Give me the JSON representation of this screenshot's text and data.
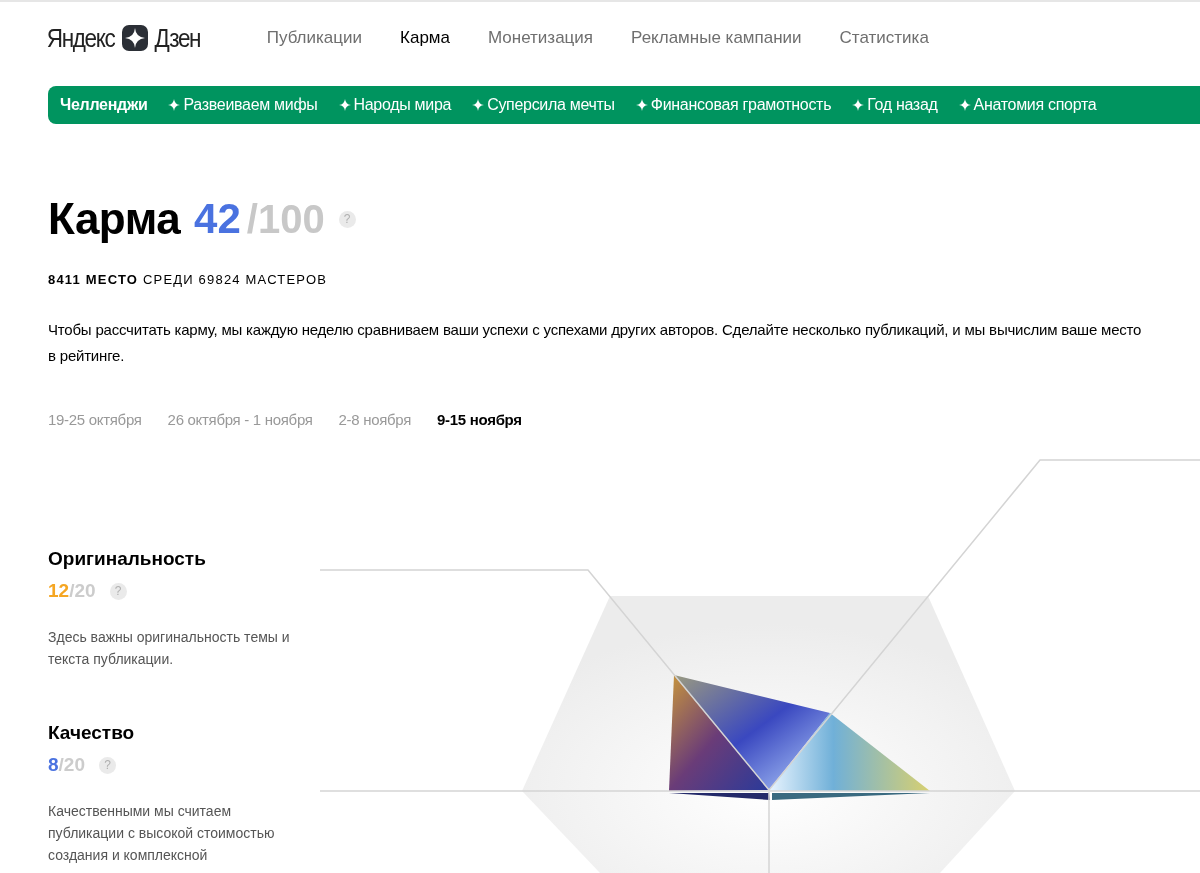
{
  "logo": {
    "left": "Яндекс",
    "right": "Дзен"
  },
  "nav": [
    {
      "label": "Публикации",
      "selected": false
    },
    {
      "label": "Карма",
      "selected": true
    },
    {
      "label": "Монетизация",
      "selected": false
    },
    {
      "label": "Рекламные кампании",
      "selected": false
    },
    {
      "label": "Статистика",
      "selected": false
    }
  ],
  "challenges": {
    "title": "Челленджи",
    "items": [
      "Развеиваем мифы",
      "Народы мира",
      "Суперсила мечты",
      "Финансовая грамотность",
      "Год назад",
      "Анатомия спорта"
    ]
  },
  "karma": {
    "title": "Карма",
    "score": "42",
    "max": "/100",
    "help": "?"
  },
  "rank": "**8411 МЕСТО** СРЕДИ 69824 МАСТЕРОВ",
  "description": "Чтобы рассчитать карму, мы каждую неделю сравниваем ваши успехи с успехами других авторов. Сделайте несколько публикаций, и мы вычислим ваше место в рейтинге.",
  "weeks": [
    {
      "label": "19-25 октября",
      "selected": false
    },
    {
      "label": "26 октября - 1 ноября",
      "selected": false
    },
    {
      "label": "2-8 ноября",
      "selected": false
    },
    {
      "label": "9-15 ноября",
      "selected": true
    }
  ],
  "metrics": [
    {
      "title": "Оригинальность",
      "score": "12",
      "max": "/20",
      "color": "#f5a623",
      "help": "?",
      "description": "Здесь важны оригинальность темы и текста публикации."
    },
    {
      "title": "Качество",
      "score": "8",
      "max": "/20",
      "color": "#4a72e0",
      "help": "?",
      "description": "Качественными мы считаем публикации с высокой стоимостью создания и комплексной"
    }
  ]
}
